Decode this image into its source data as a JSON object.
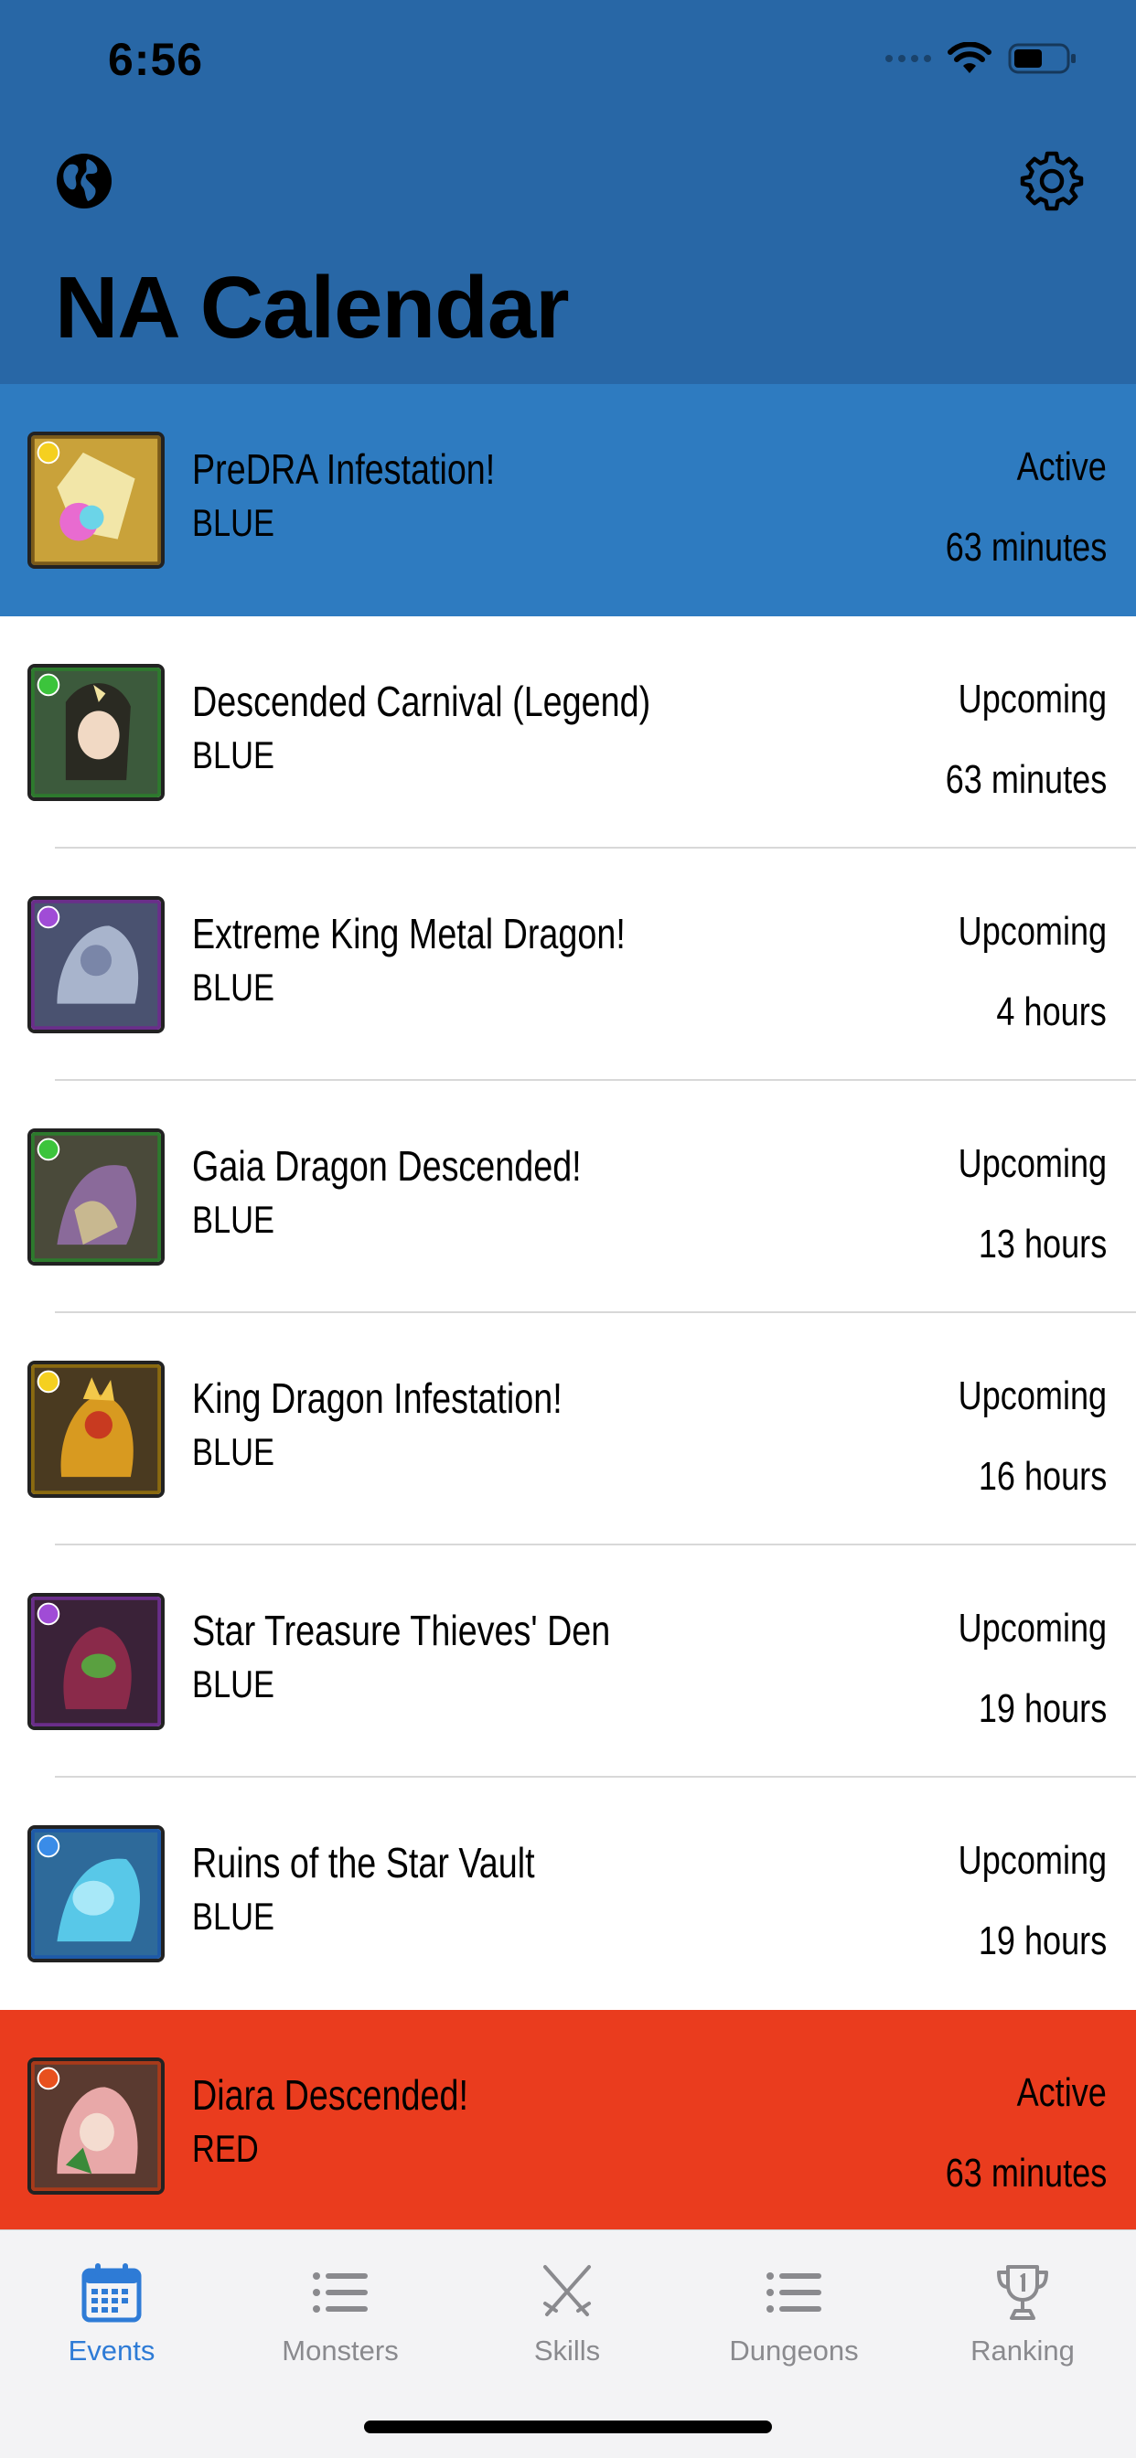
{
  "status_bar": {
    "time": "6:56"
  },
  "header": {
    "title": "NA Calendar",
    "globe_icon": "globe-icon",
    "settings_icon": "gear-icon"
  },
  "colors": {
    "header": "#2867A6",
    "active_blue": "#2E7BC0",
    "active_red": "#EA3C1E",
    "tab_selected": "#2E7BD6",
    "tab_inactive": "#8A8A8E"
  },
  "events": [
    {
      "name": "PreDRA Infestation!",
      "group": "BLUE",
      "status": "Active",
      "time": "63 minutes",
      "highlight": "blue",
      "icon": "light-attribute-monster-icon"
    },
    {
      "name": "Descended Carnival (Legend)",
      "group": "BLUE",
      "status": "Upcoming",
      "time": "63 minutes",
      "highlight": "none",
      "icon": "wood-attribute-monster-icon"
    },
    {
      "name": "Extreme King Metal Dragon!",
      "group": "BLUE",
      "status": "Upcoming",
      "time": "4 hours",
      "highlight": "none",
      "icon": "dark-attribute-monster-icon"
    },
    {
      "name": "Gaia Dragon Descended!",
      "group": "BLUE",
      "status": "Upcoming",
      "time": "13 hours",
      "highlight": "none",
      "icon": "wood-attribute-monster-icon"
    },
    {
      "name": "King Dragon Infestation!",
      "group": "BLUE",
      "status": "Upcoming",
      "time": "16 hours",
      "highlight": "none",
      "icon": "light-attribute-monster-icon"
    },
    {
      "name": "Star Treasure Thieves' Den",
      "group": "BLUE",
      "status": "Upcoming",
      "time": "19 hours",
      "highlight": "none",
      "icon": "dark-attribute-monster-icon"
    },
    {
      "name": "Ruins of the Star Vault",
      "group": "BLUE",
      "status": "Upcoming",
      "time": "19 hours",
      "highlight": "none",
      "icon": "water-attribute-monster-icon"
    },
    {
      "name": "Diara Descended!",
      "group": "RED",
      "status": "Active",
      "time": "63 minutes",
      "highlight": "red",
      "icon": "fire-attribute-monster-icon"
    }
  ],
  "tabs": [
    {
      "label": "Events",
      "icon": "calendar-icon",
      "selected": true
    },
    {
      "label": "Monsters",
      "icon": "list-icon",
      "selected": false
    },
    {
      "label": "Skills",
      "icon": "crossed-swords-icon",
      "selected": false
    },
    {
      "label": "Dungeons",
      "icon": "list-icon",
      "selected": false
    },
    {
      "label": "Ranking",
      "icon": "trophy-icon",
      "selected": false
    }
  ]
}
